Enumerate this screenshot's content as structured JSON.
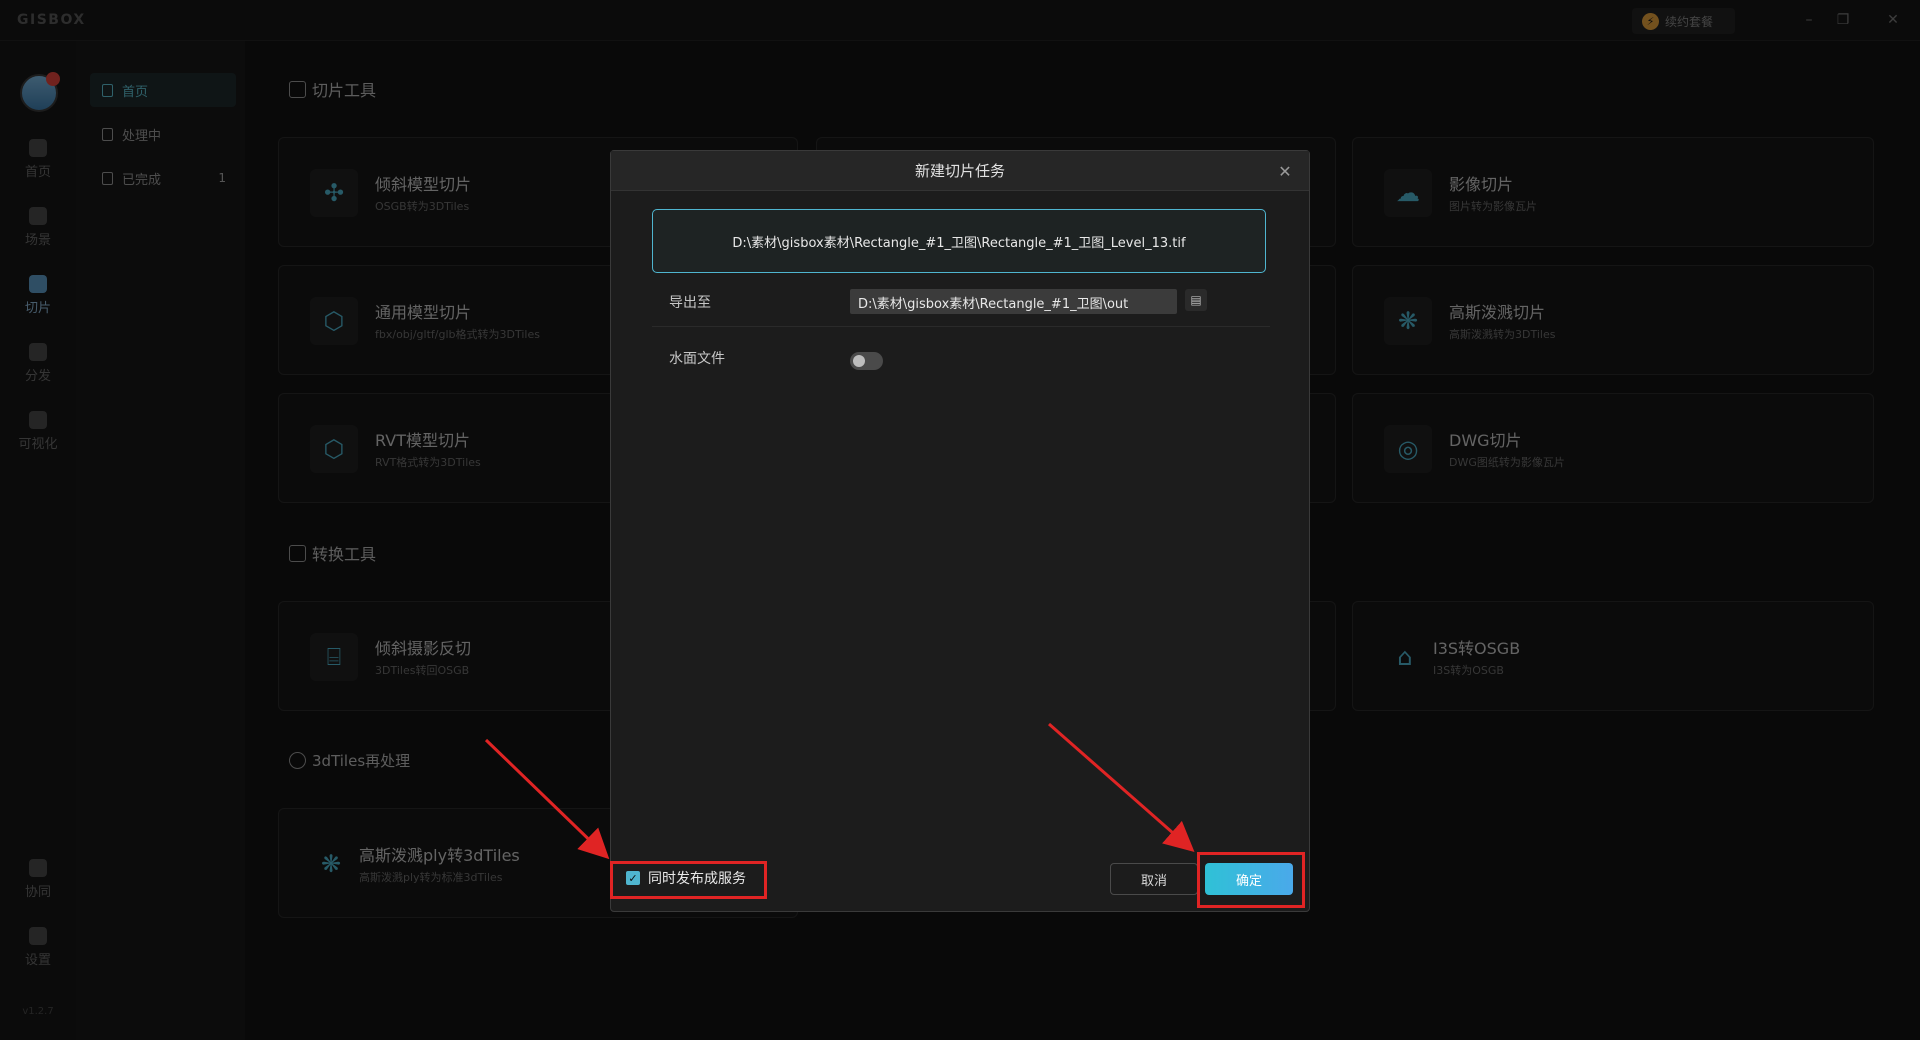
{
  "app": {
    "logo": "GISBOX",
    "promo_label": "续约套餐",
    "version": "v1.2.7"
  },
  "window_controls": {
    "minimize": "–",
    "restore": "❐",
    "close": "✕"
  },
  "rail": {
    "items": [
      {
        "label": "首页",
        "icon": "home-icon"
      },
      {
        "label": "场景",
        "icon": "cube-icon"
      },
      {
        "label": "切片",
        "icon": "slice-icon",
        "active": true
      },
      {
        "label": "分发",
        "icon": "share-icon"
      },
      {
        "label": "可视化",
        "icon": "visual-icon"
      }
    ],
    "bottom": [
      {
        "label": "协同",
        "icon": "lock-icon"
      },
      {
        "label": "设置",
        "icon": "gear-icon"
      }
    ]
  },
  "subnav": {
    "items": [
      {
        "label": "首页",
        "active": true
      },
      {
        "label": "处理中"
      },
      {
        "label": "已完成",
        "count": "1"
      }
    ]
  },
  "sections": {
    "slice_tools": "切片工具",
    "convert_tools": "转换工具",
    "tiles_reprocess": "3dTiles再处理"
  },
  "cards": {
    "oblique": {
      "title": "倾斜模型切片",
      "sub": "OSGB转为3DTiles"
    },
    "generic": {
      "title": "通用模型切片",
      "sub": "fbx/obj/gltf/glb格式转为3DTiles"
    },
    "rvt": {
      "title": "RVT模型切片",
      "sub": "RVT格式转为3DTiles"
    },
    "imagery": {
      "title": "影像切片",
      "sub": "图片转为影像瓦片"
    },
    "gaussian": {
      "title": "高斯泼溅切片",
      "sub": "高斯泼溅转为3DTiles"
    },
    "dwg": {
      "title": "DWG切片",
      "sub": "DWG图纸转为影像瓦片"
    },
    "reverse": {
      "title": "倾斜摄影反切",
      "sub": "3DTiles转回OSGB"
    },
    "i3s": {
      "title": "I3S转OSGB",
      "sub": "I3S转为OSGB"
    },
    "ply": {
      "title": "高斯泼溅ply转3dTiles",
      "sub": "高斯泼溅ply转为标准3dTiles"
    }
  },
  "modal": {
    "title": "新建切片任务",
    "source_path": "D:\\素材\\gisbox素材\\Rectangle_#1_卫图\\Rectangle_#1_卫图_Level_13.tif",
    "export_label": "导出至",
    "export_path": "D:\\素材\\gisbox素材\\Rectangle_#1_卫图\\out",
    "water_label": "水面文件",
    "water_on": false,
    "publish_label": "同时发布成服务",
    "publish_checked": true,
    "cancel_label": "取消",
    "ok_label": "确定"
  },
  "colors": {
    "accent": "#4fb5cf",
    "annotation": "#e02424"
  }
}
